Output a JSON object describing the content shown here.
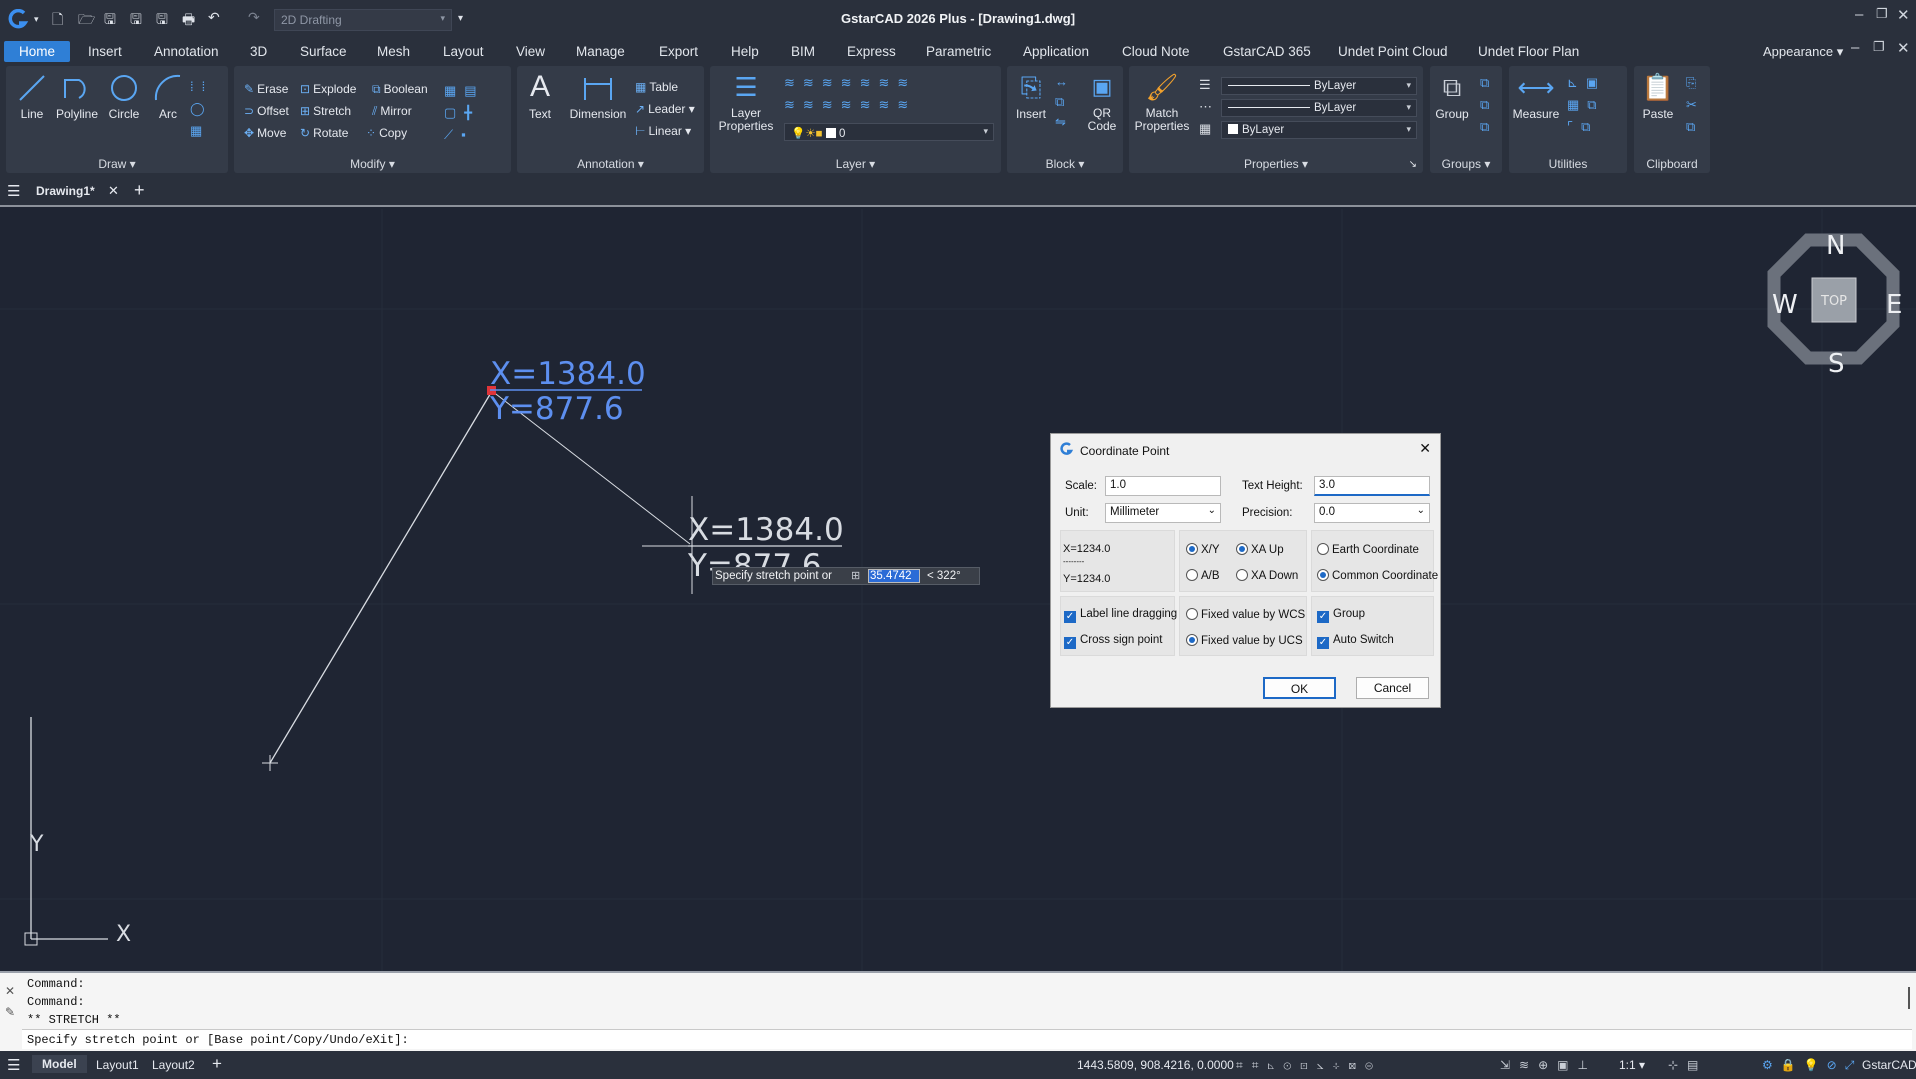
{
  "app": {
    "title": "GstarCAD 2026 Plus - [Drawing1.dwg]",
    "workspace": "2D Drafting"
  },
  "menu": [
    "Home",
    "Insert",
    "Annotation",
    "3D",
    "Surface",
    "Mesh",
    "Layout",
    "View",
    "Manage",
    "Export",
    "Help",
    "BIM",
    "Express",
    "Parametric",
    "Application",
    "Cloud Note",
    "GstarCAD 365",
    "Undet Point Cloud",
    "Undet Floor Plan"
  ],
  "appearance": "Appearance",
  "ribbon": {
    "draw": {
      "title": "Draw",
      "line": "Line",
      "polyline": "Polyline",
      "circle": "Circle",
      "arc": "Arc"
    },
    "modify": {
      "title": "Modify",
      "erase": "Erase",
      "explode": "Explode",
      "boolean": "Boolean",
      "offset": "Offset",
      "stretch": "Stretch",
      "mirror": "Mirror",
      "move": "Move",
      "rotate": "Rotate",
      "copy": "Copy"
    },
    "annotation": {
      "title": "Annotation",
      "text": "Text",
      "dimension": "Dimension",
      "table": "Table",
      "leader": "Leader",
      "linear": "Linear"
    },
    "layer": {
      "title": "Layer",
      "layer_properties": "Layer Properties",
      "layer_value": "0"
    },
    "block": {
      "title": "Block",
      "insert": "Insert",
      "qr": "QR Code"
    },
    "properties": {
      "title": "Properties",
      "match": "Match Properties",
      "bylayer1": "ByLayer",
      "bylayer2": "ByLayer",
      "bylayer3": "ByLayer"
    },
    "groups": {
      "title": "Groups",
      "group": "Group"
    },
    "utilities": {
      "title": "Utilities",
      "measure": "Measure"
    },
    "clipboard": {
      "title": "Clipboard",
      "paste": "Paste"
    }
  },
  "doc_tab": "Drawing1*",
  "canvas": {
    "label_top_x": "X=1384.0",
    "label_top_y": "Y=877.6",
    "label_cursor_x": "X=1384.0",
    "label_cursor_y": "Y=877.6",
    "prompt": "Specify stretch point or",
    "input_value": "35.4742",
    "angle": "< 322°",
    "viewcube": {
      "n": "N",
      "s": "S",
      "e": "E",
      "w": "W",
      "top": "TOP"
    },
    "ucs_x": "X",
    "ucs_y": "Y"
  },
  "dialog": {
    "title": "Coordinate Point",
    "scale_label": "Scale:",
    "scale_value": "1.0",
    "text_height_label": "Text Height:",
    "text_height_value": "3.0",
    "unit_label": "Unit:",
    "unit_value": "Millimeter",
    "precision_label": "Precision:",
    "precision_value": "0.0",
    "preview_x": "X=1234.0",
    "preview_sep": "--------",
    "preview_y": "Y=1234.0",
    "opt_xy": "X/Y",
    "opt_ab": "A/B",
    "opt_xa_up": "XA Up",
    "opt_xa_down": "XA Down",
    "opt_earth": "Earth Coordinate",
    "opt_common": "Common Coordinate",
    "chk_label_drag": "Label line dragging",
    "chk_cross": "Cross sign point",
    "opt_wcs": "Fixed value by WCS",
    "opt_ucs": "Fixed value by UCS",
    "chk_group": "Group",
    "chk_auto": "Auto Switch",
    "ok": "OK",
    "cancel": "Cancel"
  },
  "command": {
    "line1": "Command:",
    "line2": "Command:",
    "line3": "** STRETCH **",
    "line4": "Specify stretch point or [Base point/Copy/Undo/eXit]:"
  },
  "status": {
    "model": "Model",
    "layout1": "Layout1",
    "layout2": "Layout2",
    "coords": "1443.5809, 908.4216, 0.0000",
    "scale": "1:1",
    "brand": "GstarCAD"
  }
}
